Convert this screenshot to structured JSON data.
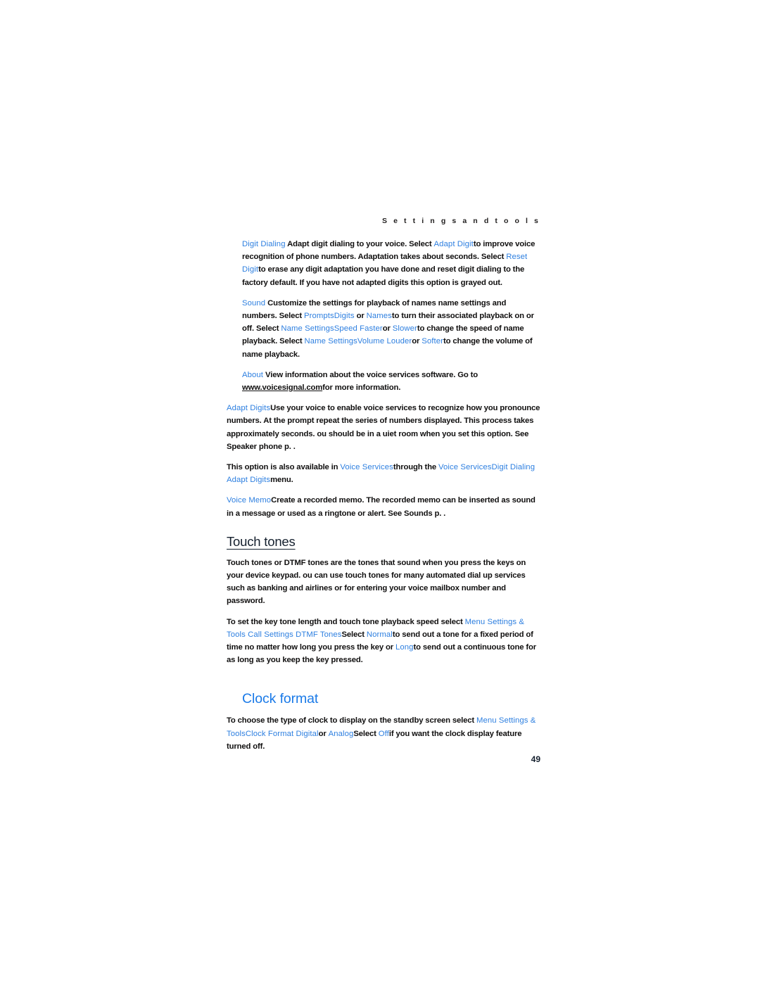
{
  "page": {
    "running_header": "S e t t i n g s   a n d   t o o l s",
    "folio": "49",
    "accent_blue": "#2d7fe0",
    "heading_blue": "#1a7ae8",
    "heading_dark": "#15202e",
    "body_color": "#100f0f",
    "background": "#ffffff"
  },
  "body": {
    "p1": {
      "term": "Digit Dialing",
      "text_a": " Adapt digit dialing to your voice. Select ",
      "term_b": "Adapt Digit",
      "text_b": "to improve voice recognition of phone numbers. Adaptation takes about    seconds. Select ",
      "term_c": "Reset Digit",
      "text_c": "to erase any digit adaptation you have done and reset digit dialing to the factory default. If you have not adapted digits  this option is grayed out."
    },
    "p2": {
      "term": "Sound",
      "text_a": " Customize the settings for playback of names  name settings  and numbers. Select ",
      "term_b": "Prompts",
      "term_c": "Digits",
      "text_b": " or ",
      "term_d": "Names",
      "text_c": "to turn their associated playback on or off. Select ",
      "term_e": "Name Settings",
      "term_f": "Speed  Faster",
      "text_d": "or ",
      "term_g": "Slower",
      "text_e": "to change the speed of name playback. Select ",
      "term_h": "Name Settings",
      "term_i": "Volume   Louder",
      "text_f": "or ",
      "term_j": "Softer",
      "text_g": "to change the volume of name playback."
    },
    "p3": {
      "term": "About",
      "text_a": "  View information about the voice services software. Go to ",
      "url": "www.voicesignal.com",
      "text_b": "for more information."
    },
    "p4": {
      "term": "Adapt Digits",
      "text_a": "Use your voice to enable voice services to recognize how you pronounce numbers. At the prompt  repeat the series of numbers displayed. This process takes approximately     seconds.  ou should be in a  uiet room when you set this option. See  Speaker phone   p.   ."
    },
    "p5": {
      "text_a": "This option is also available in ",
      "term_a": "Voice Services",
      "text_b": "through the ",
      "term_b": "Voice Services",
      "term_c": "Digit Dialing   Adapt Digits",
      "text_c": "menu."
    },
    "p6": {
      "term": "Voice Memo",
      "text_a": "Create a recorded memo. The recorded memo can be inserted as sound in a message  or used as a ringtone or alert. See  Sounds    p.   ."
    },
    "heading_touch_tones": "Touch tones",
    "p7": {
      "text_a": "Touch tones  or DTMF tones  are the tones that sound when you press the keys on your device keypad.   ou can use touch tones for many automated dial  up services such as banking and airlines  or for entering your voice mailbox number and password."
    },
    "p8": {
      "text_a": "To set the key tone length and touch tone playback speed  select ",
      "term_a": "Menu   Settings & Tools  Call Settings  DTMF Tones",
      "text_b": "Select ",
      "term_b": "Normal",
      "text_c": "to send out a tone for a fixed period of time no matter how long you press the key or ",
      "term_c": "Long",
      "text_d": "to send out a continuous tone for as long as you keep the key pressed."
    },
    "heading_clock_format": "Clock format",
    "p9": {
      "text_a": "To choose the type of clock to display on the standby screen  select ",
      "term_a": "Menu   Settings & Tools",
      "term_b": "Clock Format  Digital",
      "text_b": "or ",
      "term_c": "Analog",
      "text_c": "Select ",
      "term_d": "Off",
      "text_d": "if you want the clock display feature turned off."
    }
  }
}
